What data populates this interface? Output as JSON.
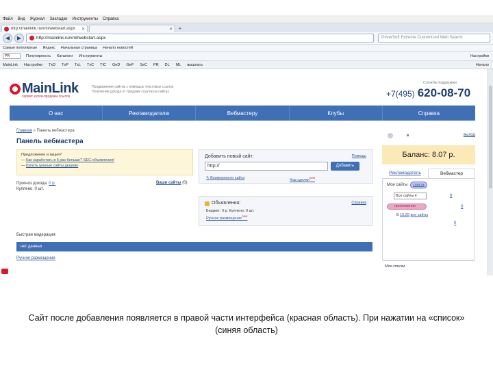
{
  "browser": {
    "menu": [
      "Файл",
      "Вид",
      "Журнал",
      "Закладки",
      "Инструменты",
      "Справка"
    ],
    "tabs": [
      {
        "label": "http://mainlink.ru/xmi/webstart.aspx"
      },
      {
        "label": ""
      }
    ],
    "new_tab": "+",
    "address": "http://mainlink.ru/xml/webstart.aspx",
    "search_placeholder": "DriverSoft Extreme Customized Web Search",
    "bookmarks": [
      "Самые популярные",
      "Яндекс",
      "Начальная страница",
      "Начало новостей"
    ],
    "toolbar2": {
      "items": [
        "Популярность",
        "Каталоги",
        "Инструменты"
      ],
      "right": "Настройки"
    },
    "toolbar3": {
      "items": [
        "MainLink",
        "Настройки",
        "TxD",
        "TxP",
        "TxL",
        "TxC",
        "TIC",
        "GeD",
        "GeP",
        "SeC",
        "PR",
        "DL",
        "ML",
        "вышлать"
      ],
      "right": "Начало"
    }
  },
  "site": {
    "logo": "MainLink",
    "tagline": "сервис купли-продажи ссылок",
    "promo": [
      "Продвижение сайтов с помощью текстовых ссылок",
      "Получение дохода от продажи ссылок на сайтах"
    ],
    "support_label": "Служба поддержки",
    "phone_code": "+7(495)",
    "phone_number": "620-08-70",
    "nav": [
      "О нас",
      "Рекламодателю",
      "Вебмастеру",
      "Клубы",
      "Справка"
    ],
    "breadcrumb": {
      "home": "Главная",
      "sep": " » ",
      "current": "Панель вебмастера"
    },
    "page_title": "Панель вебмастера",
    "notice": {
      "title": "Предложение и акция?",
      "line1": "Как заработать в 5 раз больше? SEC-объявления!",
      "line2": "Купить ценные сайты дешево"
    },
    "income": {
      "label": "Прогноз дохода:",
      "value": "0 р.",
      "purchases": "Куплено: 0 шт."
    },
    "all_sites": {
      "label": "Ваши сайты",
      "count": "(0)"
    },
    "add_site": {
      "title": "Добавить новый сайт:",
      "help": "Помощь",
      "input_value": "http://",
      "button": "Добавить",
      "hint1": "Возможности сайта",
      "hint2": "Ход сделки",
      "new_badge": "new"
    },
    "ads": {
      "title": "Объявления:",
      "ref": "Справка",
      "line1": "Бюджет: 0 р. Куплено: 0 шт.",
      "line2": "Ручное размещение",
      "new_badge": "new"
    },
    "moderation": {
      "label": "Быстрая модерация:",
      "empty": "нет данных",
      "manual": "Ручное размещение"
    },
    "right": {
      "exit": "выход",
      "balance": "Баланс: 8.07 р.",
      "tab_advertiser": "Рекламодатель",
      "tab_webmaster": "Вебмастер",
      "my_sites": "Мои сайты",
      "list_button": "список",
      "select_value": "Все сайты",
      "v1": "0",
      "site_label": "приложение",
      "v2": "0",
      "row3_prefix": "Б",
      "row3_date": "15.25",
      "row3_rest": "все сайты",
      "v3": "0"
    },
    "footer_note": "Мои списки"
  },
  "caption": "Сайт после добавления появляется в правой части интерфейса (красная область). При нажатии на «список» (синяя область)",
  "colors": {
    "brand_blue": "#3f6fb4",
    "brand_dark": "#1f3e72",
    "brand_red": "#d71a2a",
    "balance_bg": "#fbe9b8",
    "highlight_red": "#e8a7c2",
    "highlight_blue": "#c9c6f3"
  }
}
